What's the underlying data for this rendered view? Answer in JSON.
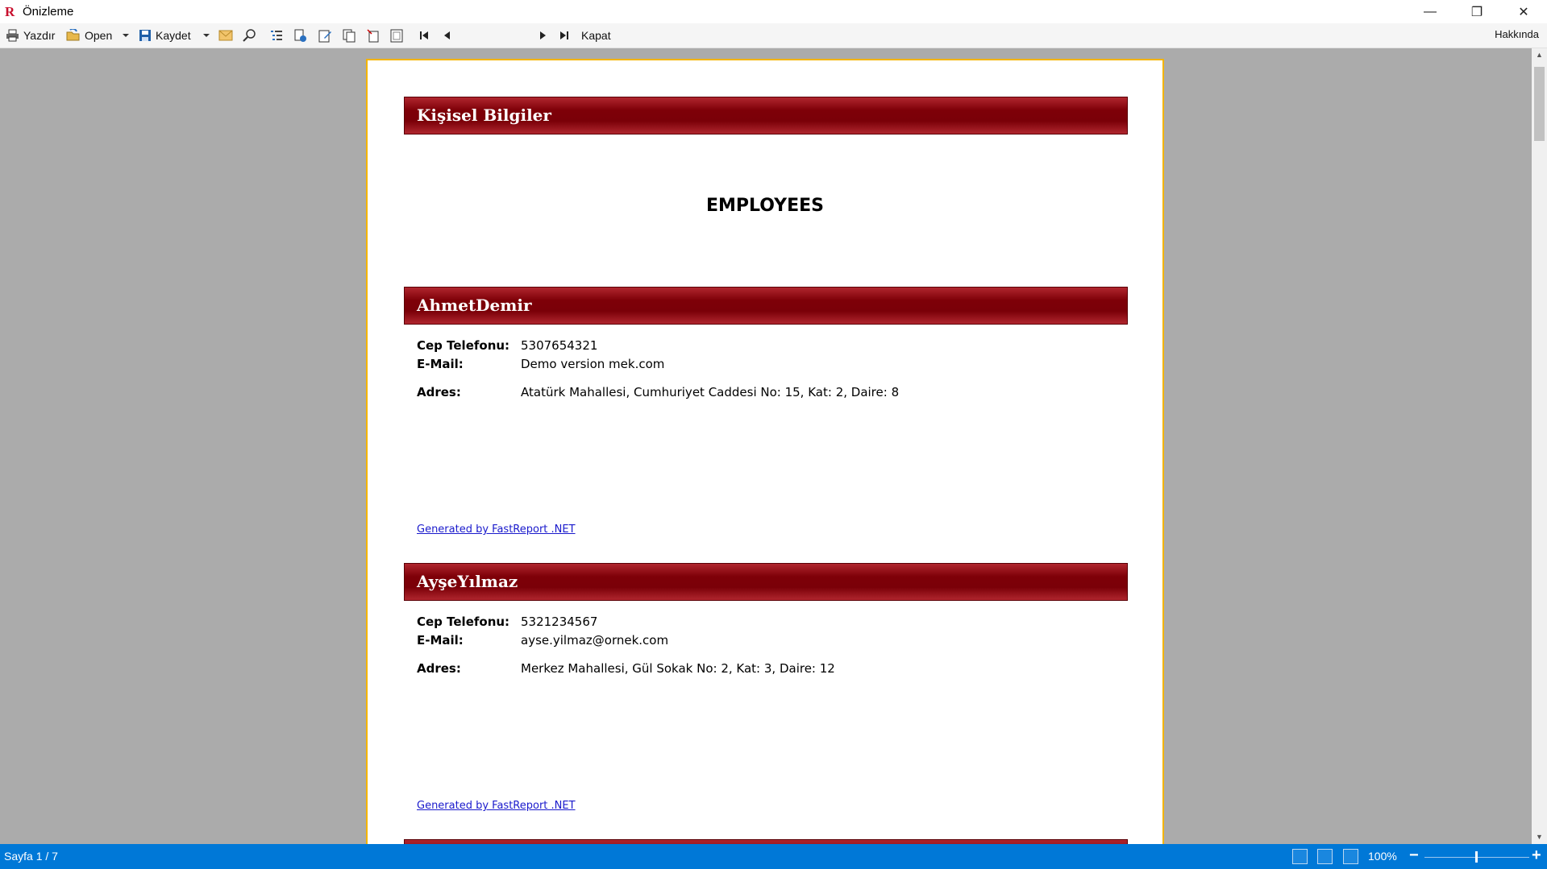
{
  "window": {
    "title": "Önizleme",
    "controls": {
      "minimize": "—",
      "restore": "❐",
      "close": "✕"
    }
  },
  "toolbar": {
    "print_label": "Yazdır",
    "open_label": "Open",
    "save_label": "Kaydet",
    "page_current": "1",
    "page_total": "/ 7",
    "close_label": "Kapat",
    "about_label": "Hakkında"
  },
  "report": {
    "header_band": "Kişisel Bilgiler",
    "title": "EMPLOYEES",
    "labels": {
      "phone": "Cep Telefonu:",
      "email": "E-Mail:",
      "address": "Adres:"
    },
    "employees": [
      {
        "name": "AhmetDemir",
        "phone": "5307654321",
        "email": "Demo version mek.com",
        "address": "Atatürk Mahallesi, Cumhuriyet Caddesi No: 15, Kat: 2, Daire: 8",
        "generated": "Generated by FastReport .NET"
      },
      {
        "name": "AyşeYılmaz",
        "phone": "5321234567",
        "email": "ayse.yilmaz@ornek.com",
        "address": "Merkez Mahallesi, Gül Sokak No: 2, Kat: 3, Daire: 12",
        "generated": "Generated by FastReport .NET"
      }
    ]
  },
  "statusbar": {
    "page_status": "Sayfa 1 / 7",
    "zoom": "100%",
    "zoom_minus": "−",
    "zoom_plus": "+"
  },
  "colors": {
    "band": "#7e0008",
    "paper_border": "#f4b400",
    "statusbar": "#0078d7",
    "viewer_bg": "#ababab"
  }
}
